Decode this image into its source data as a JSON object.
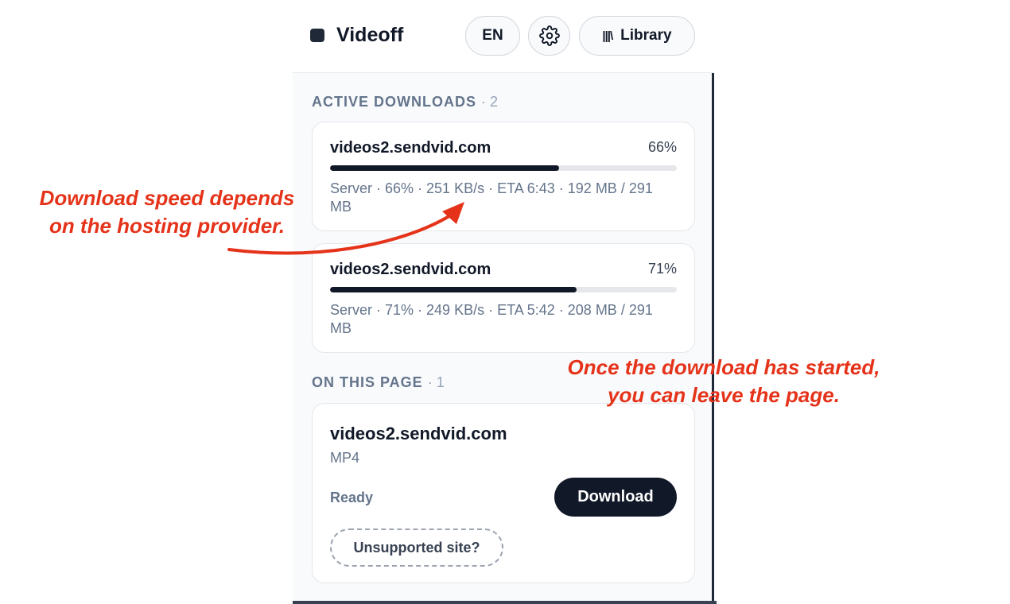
{
  "header": {
    "brand": "Videoff",
    "lang_label": "EN",
    "library_label": "Library",
    "icons": {
      "logo": "square-logo",
      "settings": "gear-icon",
      "library": "library-icon"
    }
  },
  "sections": {
    "active": {
      "label": "ACTIVE DOWNLOADS",
      "count": "· 2"
    },
    "page": {
      "label": "ON THIS PAGE",
      "count": "· 1"
    }
  },
  "downloads": [
    {
      "host": "videos2.sendvid.com",
      "percent_label": "66%",
      "progress": 0.66,
      "meta": "Server · 66% · 251 KB/s · ETA 6:43 · 192 MB / 291 MB"
    },
    {
      "host": "videos2.sendvid.com",
      "percent_label": "71%",
      "progress": 0.71,
      "meta": "Server · 71% · 249 KB/s · ETA 5:42 · 208 MB / 291 MB"
    }
  ],
  "page_item": {
    "host": "videos2.sendvid.com",
    "format": "MP4",
    "status": "Ready",
    "download_label": "Download",
    "unsupported_label": "Unsupported site?"
  },
  "annotations": {
    "left": [
      "Download speed depends",
      "on the hosting provider."
    ],
    "right": [
      "Once the download has started,",
      "you can leave the page."
    ],
    "color": "#e5331a"
  },
  "colors": {
    "accent": "#111827",
    "muted": "#64748b",
    "track": "#e5e7eb"
  }
}
